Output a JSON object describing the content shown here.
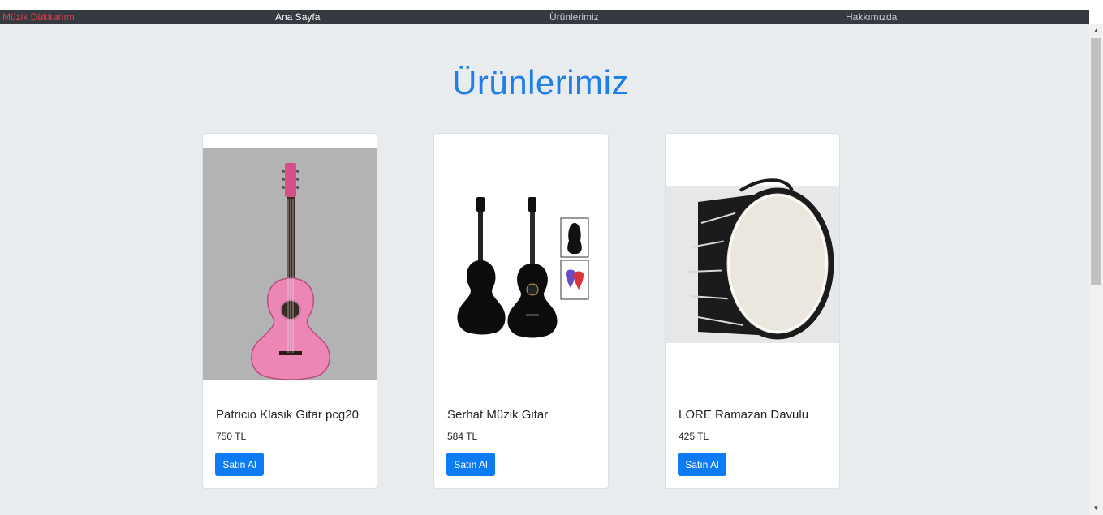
{
  "nav": {
    "brand": "Müzik Dükkanım",
    "links": [
      "Ana Sayfa",
      "Ürünlerimiz",
      "Hakkımızda"
    ]
  },
  "page": {
    "title": "Ürünlerimiz"
  },
  "products": [
    {
      "name": "Patricio Klasik Gitar pcg20",
      "price": "750 TL",
      "button": "Satın Al"
    },
    {
      "name": "Serhat Müzik Gitar",
      "price": "584 TL",
      "button": "Satın Al"
    },
    {
      "name": "LORE Ramazan Davulu",
      "price": "425 TL",
      "button": "Satın Al"
    }
  ],
  "colors": {
    "navbar": "#343a40",
    "brand": "#e83e4a",
    "accent": "#0d7bf2",
    "background": "#e9ecef"
  }
}
